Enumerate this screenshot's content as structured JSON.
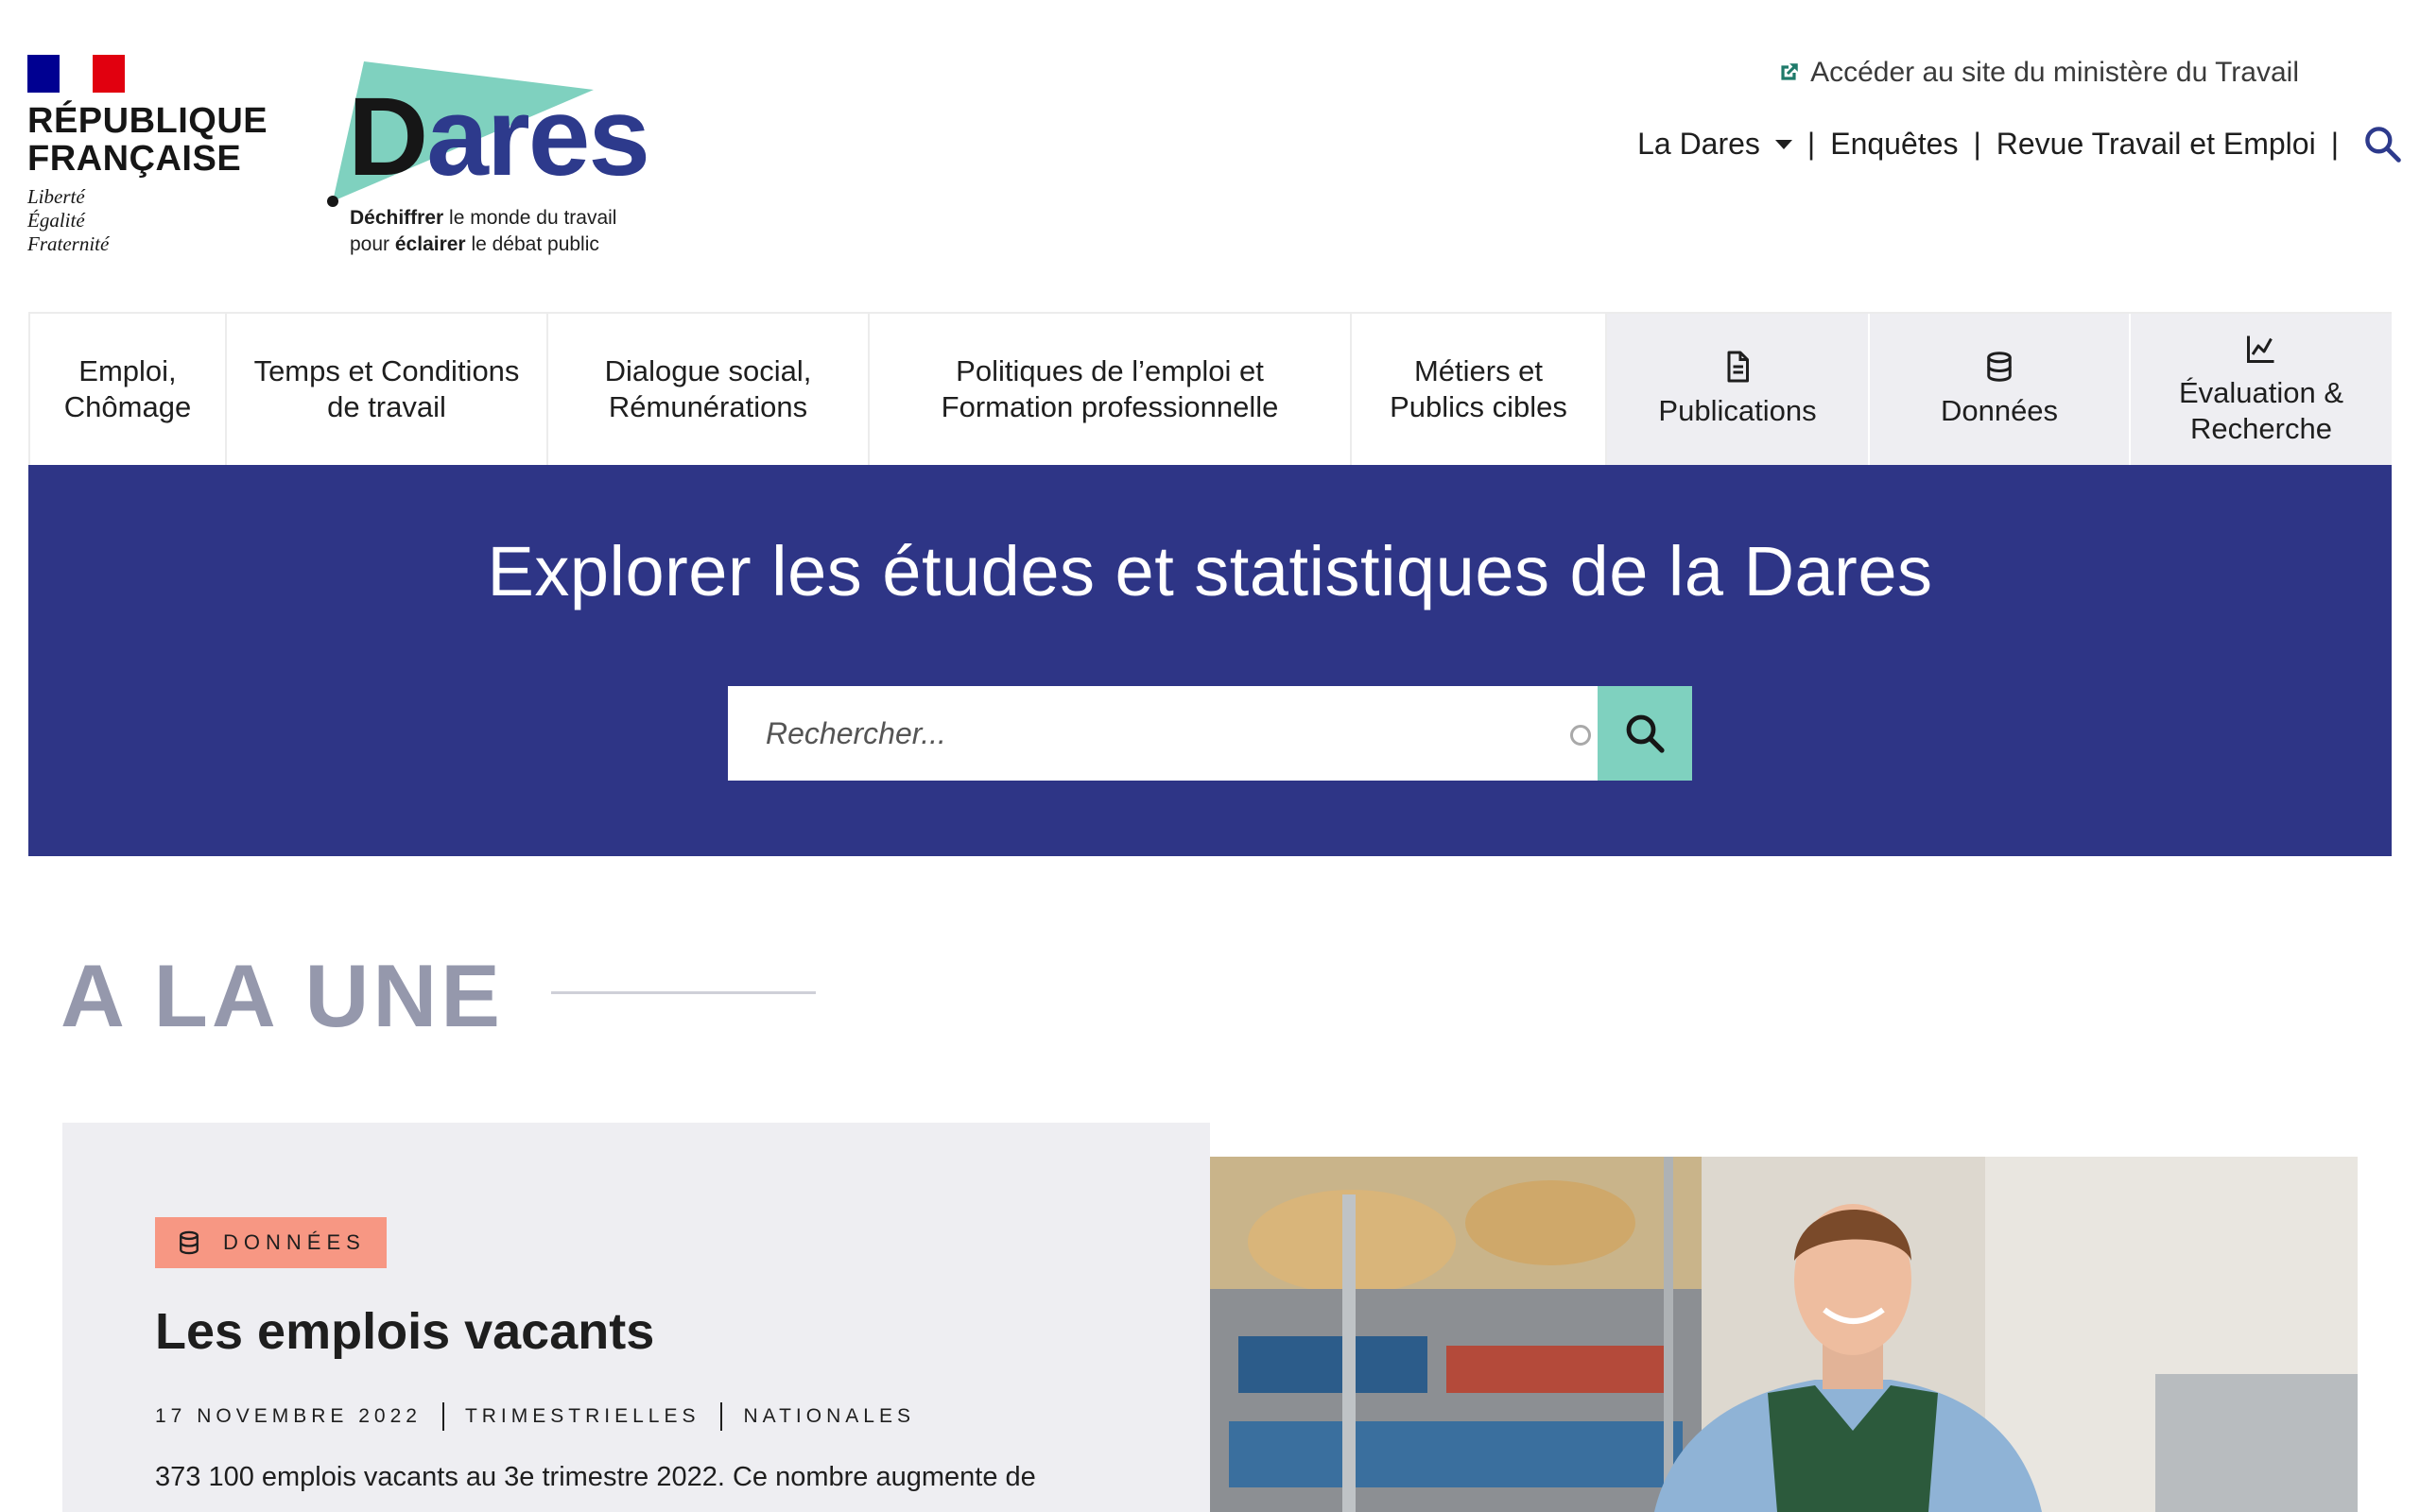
{
  "header": {
    "republique": {
      "name": "RÉPUBLIQUE\nFRANÇAISE",
      "motto": "Liberté\nÉgalité\nFraternité"
    },
    "logo": {
      "word_prefix": "D",
      "word_rest": "ares",
      "tag_line1_bold": "Déchiffrer",
      "tag_line1_rest": " le monde du travail",
      "tag_line2_pre": "pour ",
      "tag_line2_bold": "éclairer",
      "tag_line2_rest": " le débat public"
    },
    "external_link": {
      "label": "Accéder au site du ministère du Travail",
      "icon": "external-link-icon"
    },
    "top_nav": {
      "items": [
        {
          "label": "La Dares",
          "has_dropdown": true
        },
        {
          "label": "Enquêtes"
        },
        {
          "label": "Revue Travail et Emploi"
        }
      ],
      "search_icon": "search-icon"
    }
  },
  "main_nav": {
    "items": [
      {
        "label": "Emploi,\nChômage"
      },
      {
        "label": "Temps et Conditions\nde travail"
      },
      {
        "label": "Dialogue social,\nRémunérations"
      },
      {
        "label": "Politiques de l’emploi et\nFormation professionnelle"
      },
      {
        "label": "Métiers et\nPublics cibles"
      },
      {
        "label": "Publications",
        "icon": "document-icon"
      },
      {
        "label": "Données",
        "icon": "database-icon"
      },
      {
        "label": "Évaluation &\nRecherche",
        "icon": "line-chart-icon"
      }
    ]
  },
  "hero": {
    "title": "Explorer les études et statistiques de la Dares",
    "search_placeholder": "Rechercher..."
  },
  "une": {
    "title": "A LA UNE",
    "card": {
      "badge": "DONNÉES",
      "title": "Les emplois vacants",
      "meta": [
        "17 NOVEMBRE 2022",
        "TRIMESTRIELLES",
        "NATIONALES"
      ],
      "description": "373 100 emplois vacants au 3e trimestre 2022. Ce nombre augmente de"
    }
  },
  "colors": {
    "hero_bg": "#2e3586",
    "accent_teal": "#7fd1bf",
    "badge_bg": "#f79783",
    "une_title": "#9598ac",
    "dares_blue": "#2d3a8c"
  }
}
